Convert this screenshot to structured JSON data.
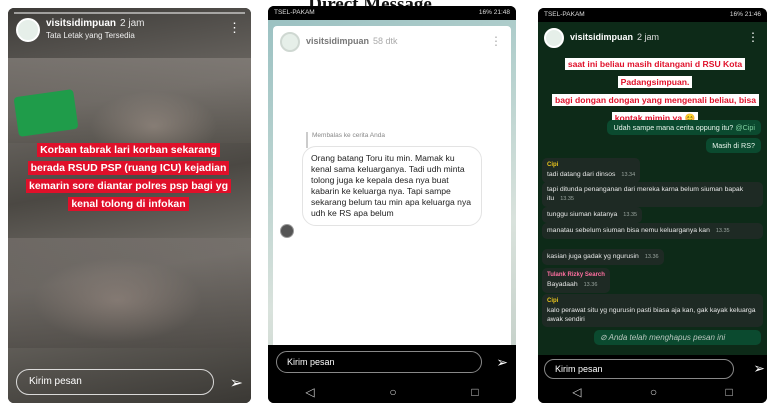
{
  "page_title": "Direct Message",
  "story1": {
    "username": "visitsidimpuan",
    "time": "2 jam",
    "location": "Tata Letak yang Tersedia",
    "caption": "Korban tabrak lari korban sekarang berada RSUD PSP (ruang ICU) kejadian kemarin sore diantar polres psp bagi yg kenal tolong di infokan",
    "reply_placeholder": "Kirim pesan",
    "menu_icon": "more-vertical-icon",
    "send_icon": "send-icon"
  },
  "story2": {
    "status_left": "TSEL-PAKAM",
    "status_right": "16% 21:48",
    "username": "visitsidimpuan",
    "time": "58 dtk",
    "reply_label": "Membalas ke cerita Anda",
    "message": "Orang batang Toru itu min. Mamak ku kenal sama keluarganya. Tadi udh minta tolong juga ke kepala desa nya buat kabarin ke keluarga nya. Tapi sampe sekarang belum tau min apa keluarga nya udh ke RS apa belum",
    "reply_placeholder": "Kirim pesan"
  },
  "story3": {
    "status_left": "TSEL-PAKAM",
    "status_right": "16% 21:46",
    "username": "visitsidimpuan",
    "time": "2 jam",
    "caption_top": "saat ini beliau masih ditangani d RSU Kota Padangsimpuan.",
    "caption_bottom": "bagi dongan dongan yang mengenali beliau, bisa kontak mimin ya 😊",
    "out_msg1": "Udah sampe mana cerita oppung itu?",
    "out_msg1_tag": "@Cipi",
    "out_msg2": "Masih di RS?",
    "chats": [
      {
        "sender": "Cipi",
        "text": "tadi datang dari dinsos",
        "time": "13.34"
      },
      {
        "sender": "",
        "text": "tapi ditunda penanganan dari mereka karna belum siuman bapak itu",
        "time": "13.35"
      },
      {
        "sender": "",
        "text": "tunggu siuman katanya",
        "time": "13.35"
      },
      {
        "sender": "",
        "text": "manatau sebelum siuman bisa nemu keluarganya kan",
        "time": "13.35"
      },
      {
        "sender": "",
        "text": "kasian juga gadak yg ngurusin",
        "time": "13.36"
      },
      {
        "sender": "Tulank Rizky Search",
        "text": "Bayadaah",
        "time": "13.36"
      },
      {
        "sender": "Cipi",
        "text": "kalo perawat situ yg ngurusin pasti biasa aja kan, gak kayak keluarga awak sendiri",
        "time": "13.37"
      }
    ],
    "deleted": "Anda telah menghapus pesan ini",
    "reply_placeholder": "Kirim pesan"
  }
}
